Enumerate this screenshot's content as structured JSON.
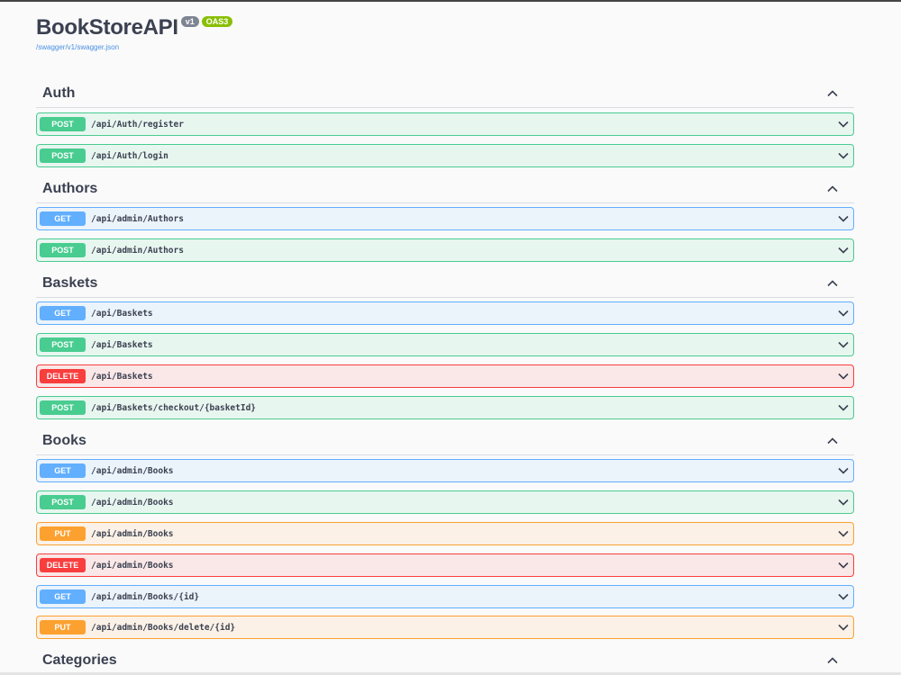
{
  "header": {
    "title": "BookStoreAPI",
    "version_badge": "v1",
    "oas_badge": "OAS3",
    "spec_link": "/swagger/v1/swagger.json"
  },
  "colors": {
    "post": "#49cc90",
    "get": "#61affe",
    "delete": "#f93e3e",
    "put": "#fca130"
  },
  "icons": {
    "collapse": "chevron-up-icon",
    "expand": "chevron-down-icon"
  },
  "tags": [
    {
      "name": "Auth",
      "operations": [
        {
          "method": "POST",
          "path": "/api/Auth/register"
        },
        {
          "method": "POST",
          "path": "/api/Auth/login"
        }
      ]
    },
    {
      "name": "Authors",
      "operations": [
        {
          "method": "GET",
          "path": "/api/admin/Authors"
        },
        {
          "method": "POST",
          "path": "/api/admin/Authors"
        }
      ]
    },
    {
      "name": "Baskets",
      "operations": [
        {
          "method": "GET",
          "path": "/api/Baskets"
        },
        {
          "method": "POST",
          "path": "/api/Baskets"
        },
        {
          "method": "DELETE",
          "path": "/api/Baskets"
        },
        {
          "method": "POST",
          "path": "/api/Baskets/checkout/{basketId}"
        }
      ]
    },
    {
      "name": "Books",
      "operations": [
        {
          "method": "GET",
          "path": "/api/admin/Books"
        },
        {
          "method": "POST",
          "path": "/api/admin/Books"
        },
        {
          "method": "PUT",
          "path": "/api/admin/Books"
        },
        {
          "method": "DELETE",
          "path": "/api/admin/Books"
        },
        {
          "method": "GET",
          "path": "/api/admin/Books/{id}"
        },
        {
          "method": "PUT",
          "path": "/api/admin/Books/delete/{id}"
        }
      ]
    },
    {
      "name": "Categories",
      "operations": []
    }
  ]
}
